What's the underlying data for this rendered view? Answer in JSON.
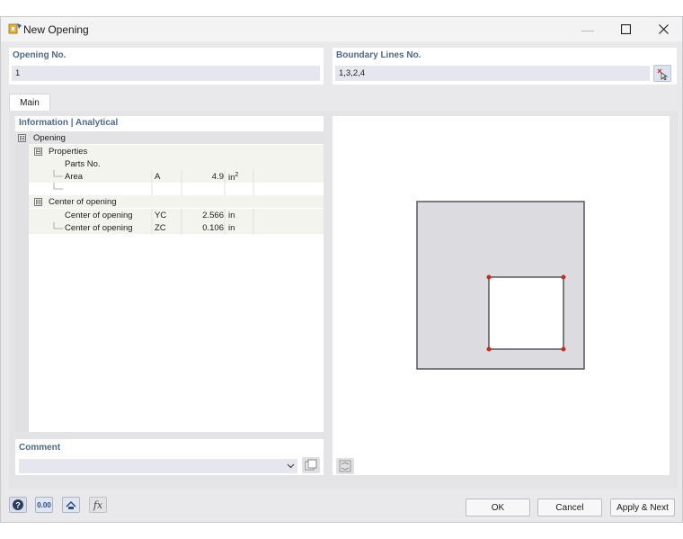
{
  "window": {
    "title": "New Opening"
  },
  "opening_no": {
    "label": "Opening No.",
    "value": "1"
  },
  "boundary_lines": {
    "label": "Boundary Lines No.",
    "value": "1,3,2,4"
  },
  "tabs": [
    {
      "label": "Main"
    }
  ],
  "info": {
    "title": "Information | Analytical",
    "root": {
      "label": "Opening",
      "expander": "⊟"
    },
    "properties": {
      "label": "Properties",
      "expander": "⊟",
      "rows": [
        {
          "name": "Parts No.",
          "symbol": "",
          "value": "",
          "unit": ""
        },
        {
          "name": "Area",
          "symbol": "A",
          "value": "4.9",
          "unit": "in",
          "unit_sup": "2"
        }
      ]
    },
    "center": {
      "label": "Center of opening",
      "expander": "⊟",
      "rows": [
        {
          "name": "Center of opening",
          "symbol": "YC",
          "value": "2.566",
          "unit": "in"
        },
        {
          "name": "Center of opening",
          "symbol": "ZC",
          "value": "0.106",
          "unit": "in"
        }
      ]
    }
  },
  "comment": {
    "label": "Comment",
    "value": ""
  },
  "buttons": {
    "ok": "OK",
    "cancel": "Cancel",
    "apply_next": "Apply & Next"
  },
  "bottom_tools": {
    "units_label": "0.00"
  },
  "colors": {
    "accent_label": "#4d6a8a",
    "vertex": "#cc2a1a",
    "shape_fill": "#dcdce0",
    "shape_stroke": "#555560"
  }
}
